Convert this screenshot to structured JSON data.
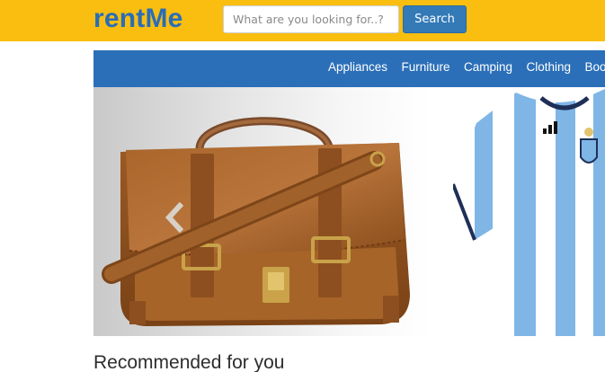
{
  "header": {
    "logo": "rentMe",
    "search": {
      "placeholder": "What are you looking for..?",
      "value": "",
      "button_label": "Search"
    }
  },
  "nav": {
    "categories": [
      "Appliances",
      "Furniture",
      "Camping",
      "Clothing",
      "Books"
    ]
  },
  "carousel": {
    "slides": [
      {
        "icon": "leather-messenger-bag-image"
      },
      {
        "icon": "argentina-football-jersey-image"
      }
    ],
    "prev_icon": "chevron-left-icon"
  },
  "main": {
    "recommended_heading": "Recommended for you"
  },
  "colors": {
    "topbar": "#f9be10",
    "brand_blue": "#2a6db7",
    "nav_blue": "#2b6fb8",
    "button_blue": "#337ab7"
  }
}
